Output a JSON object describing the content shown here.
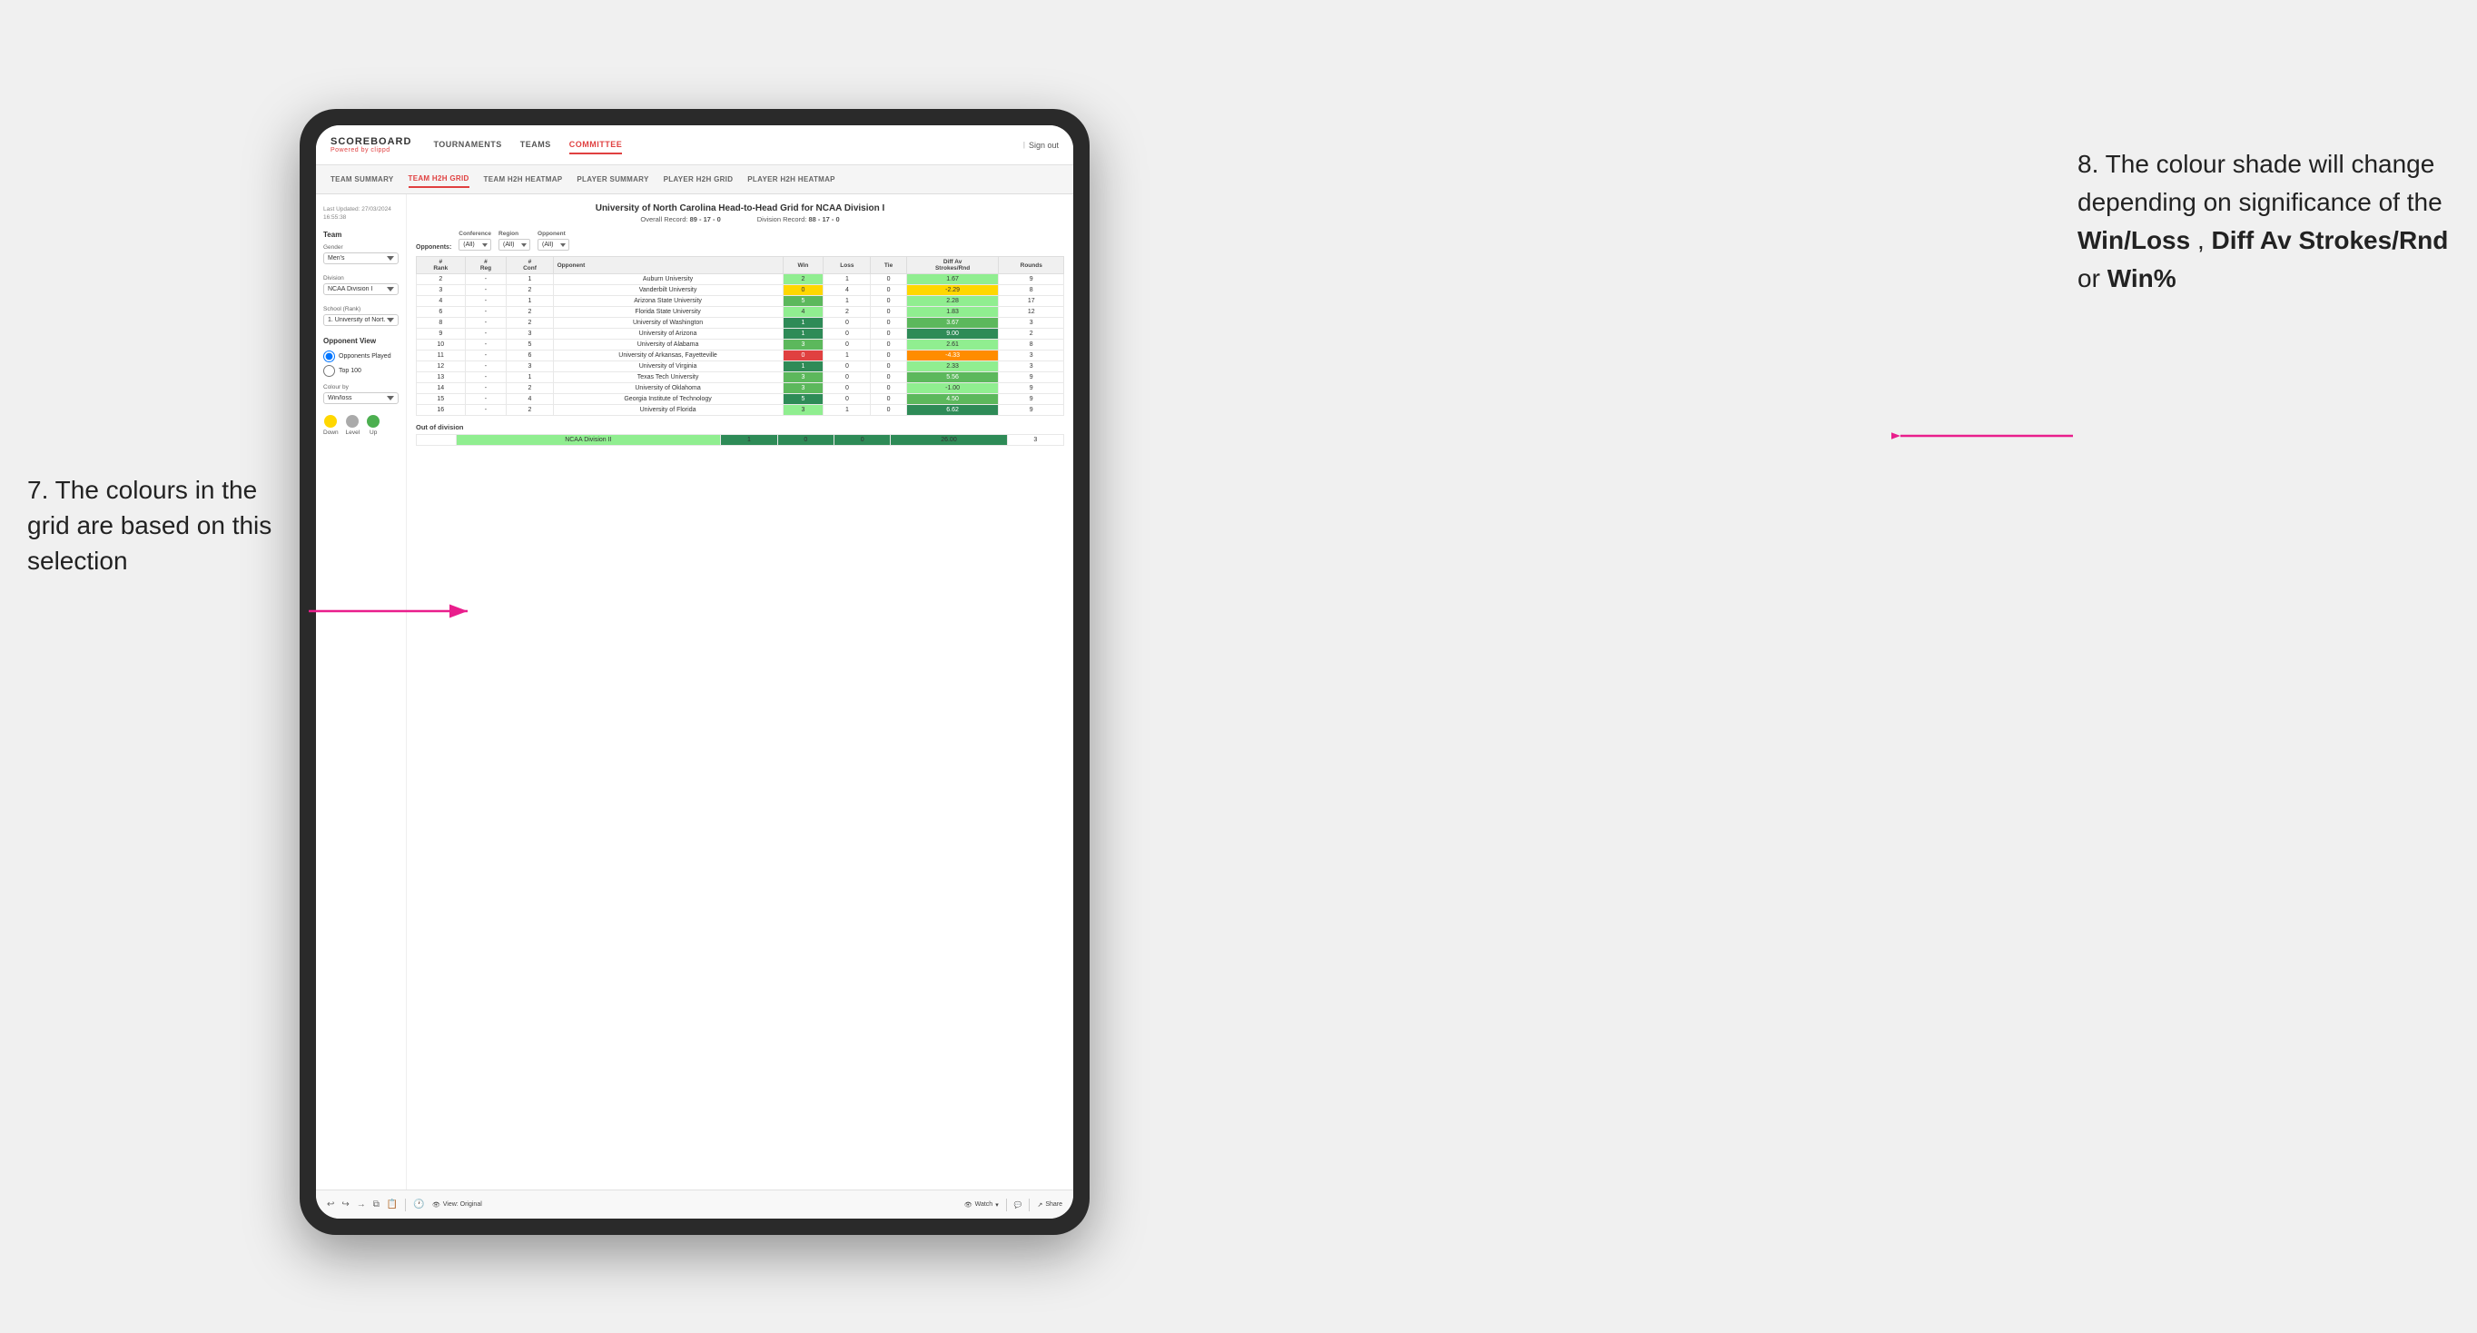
{
  "annotations": {
    "left": {
      "number": "7.",
      "text": "The colours in the grid are based on this selection"
    },
    "right": {
      "number": "8.",
      "intro": "The colour shade will change depending on significance of the ",
      "bold1": "Win/Loss",
      "sep1": ", ",
      "bold2": "Diff Av Strokes/Rnd",
      "sep2": " or ",
      "bold3": "Win%"
    }
  },
  "nav": {
    "logo": "SCOREBOARD",
    "logo_sub": "Powered by clippd",
    "links": [
      "TOURNAMENTS",
      "TEAMS",
      "COMMITTEE"
    ],
    "active_link": "COMMITTEE",
    "sign_out": "Sign out"
  },
  "sub_nav": {
    "links": [
      "TEAM SUMMARY",
      "TEAM H2H GRID",
      "TEAM H2H HEATMAP",
      "PLAYER SUMMARY",
      "PLAYER H2H GRID",
      "PLAYER H2H HEATMAP"
    ],
    "active": "TEAM H2H GRID"
  },
  "sidebar": {
    "timestamp_label": "Last Updated: 27/03/2024",
    "timestamp_time": "16:55:38",
    "team_label": "Team",
    "gender_label": "Gender",
    "gender_value": "Men's",
    "division_label": "Division",
    "division_value": "NCAA Division I",
    "school_label": "School (Rank)",
    "school_value": "1. University of Nort...",
    "opponent_view_label": "Opponent View",
    "radio_options": [
      "Opponents Played",
      "Top 100"
    ],
    "radio_selected": "Opponents Played",
    "colour_by_label": "Colour by",
    "colour_by_value": "Win/loss",
    "legend": {
      "down": "Down",
      "level": "Level",
      "up": "Up"
    }
  },
  "grid": {
    "title": "University of North Carolina Head-to-Head Grid for NCAA Division I",
    "overall_record": "89 - 17 - 0",
    "division_record": "88 - 17 - 0",
    "filters": {
      "conference_label": "Conference",
      "conference_value": "(All)",
      "region_label": "Region",
      "region_value": "(All)",
      "opponent_label": "Opponent",
      "opponent_value": "(All)",
      "opponents_label": "Opponents:"
    },
    "col_headers": [
      "#\nRank",
      "#\nReg",
      "#\nConf",
      "Opponent",
      "Win",
      "Loss",
      "Tie",
      "Diff Av\nStrokes/Rnd",
      "Rounds"
    ],
    "rows": [
      {
        "rank": "2",
        "reg": "-",
        "conf": "1",
        "opponent": "Auburn University",
        "win": 2,
        "loss": 1,
        "tie": 0,
        "diff": "1.67",
        "rounds": 9,
        "win_color": "green-light",
        "diff_color": "green-light"
      },
      {
        "rank": "3",
        "reg": "-",
        "conf": "2",
        "opponent": "Vanderbilt University",
        "win": 0,
        "loss": 4,
        "tie": 0,
        "diff": "-2.29",
        "rounds": 8,
        "win_color": "yellow",
        "diff_color": "yellow"
      },
      {
        "rank": "4",
        "reg": "-",
        "conf": "1",
        "opponent": "Arizona State University",
        "win": 5,
        "loss": 1,
        "tie": 0,
        "diff": "2.28",
        "rounds": 17,
        "win_color": "green-med",
        "diff_color": "green-light"
      },
      {
        "rank": "6",
        "reg": "-",
        "conf": "2",
        "opponent": "Florida State University",
        "win": 4,
        "loss": 2,
        "tie": 0,
        "diff": "1.83",
        "rounds": 12,
        "win_color": "green-light",
        "diff_color": "green-light"
      },
      {
        "rank": "8",
        "reg": "-",
        "conf": "2",
        "opponent": "University of Washington",
        "win": 1,
        "loss": 0,
        "tie": 0,
        "diff": "3.67",
        "rounds": 3,
        "win_color": "green-dark",
        "diff_color": "green-med"
      },
      {
        "rank": "9",
        "reg": "-",
        "conf": "3",
        "opponent": "University of Arizona",
        "win": 1,
        "loss": 0,
        "tie": 0,
        "diff": "9.00",
        "rounds": 2,
        "win_color": "green-dark",
        "diff_color": "green-dark"
      },
      {
        "rank": "10",
        "reg": "-",
        "conf": "5",
        "opponent": "University of Alabama",
        "win": 3,
        "loss": 0,
        "tie": 0,
        "diff": "2.61",
        "rounds": 8,
        "win_color": "green-med",
        "diff_color": "green-light"
      },
      {
        "rank": "11",
        "reg": "-",
        "conf": "6",
        "opponent": "University of Arkansas, Fayetteville",
        "win": 0,
        "loss": 1,
        "tie": 0,
        "diff": "-4.33",
        "rounds": 3,
        "win_color": "red",
        "diff_color": "orange"
      },
      {
        "rank": "12",
        "reg": "-",
        "conf": "3",
        "opponent": "University of Virginia",
        "win": 1,
        "loss": 0,
        "tie": 0,
        "diff": "2.33",
        "rounds": 3,
        "win_color": "green-dark",
        "diff_color": "green-light"
      },
      {
        "rank": "13",
        "reg": "-",
        "conf": "1",
        "opponent": "Texas Tech University",
        "win": 3,
        "loss": 0,
        "tie": 0,
        "diff": "5.56",
        "rounds": 9,
        "win_color": "green-med",
        "diff_color": "green-med"
      },
      {
        "rank": "14",
        "reg": "-",
        "conf": "2",
        "opponent": "University of Oklahoma",
        "win": 3,
        "loss": 0,
        "tie": 0,
        "diff": "-1.00",
        "rounds": 9,
        "win_color": "green-med",
        "diff_color": "green-light"
      },
      {
        "rank": "15",
        "reg": "-",
        "conf": "4",
        "opponent": "Georgia Institute of Technology",
        "win": 5,
        "loss": 0,
        "tie": 0,
        "diff": "4.50",
        "rounds": 9,
        "win_color": "green-dark",
        "diff_color": "green-med"
      },
      {
        "rank": "16",
        "reg": "-",
        "conf": "2",
        "opponent": "University of Florida",
        "win": 3,
        "loss": 1,
        "tie": 0,
        "diff": "6.62",
        "rounds": 9,
        "win_color": "green-light",
        "diff_color": "green-dark"
      }
    ],
    "out_of_division": {
      "title": "Out of division",
      "rows": [
        {
          "division": "NCAA Division II",
          "win": 1,
          "loss": 0,
          "tie": 0,
          "diff": "26.00",
          "rounds": 3,
          "win_color": "green-dark",
          "diff_color": "green-dark"
        }
      ]
    }
  },
  "toolbar": {
    "view_label": "View: Original",
    "watch_label": "Watch",
    "share_label": "Share"
  }
}
